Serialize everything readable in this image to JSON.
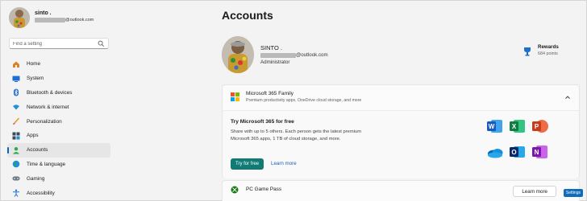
{
  "profile": {
    "name": "sinto .",
    "email_suffix": "@outlook.com"
  },
  "search": {
    "placeholder": "Find a setting"
  },
  "nav": {
    "items": [
      {
        "label": "Home",
        "icon": "home-icon"
      },
      {
        "label": "System",
        "icon": "system-icon"
      },
      {
        "label": "Bluetooth & devices",
        "icon": "bluetooth-icon"
      },
      {
        "label": "Network & internet",
        "icon": "wifi-icon"
      },
      {
        "label": "Personalization",
        "icon": "brush-icon"
      },
      {
        "label": "Apps",
        "icon": "apps-icon"
      },
      {
        "label": "Accounts",
        "icon": "accounts-icon"
      },
      {
        "label": "Time & language",
        "icon": "globe-icon"
      },
      {
        "label": "Gaming",
        "icon": "gamepad-icon"
      },
      {
        "label": "Accessibility",
        "icon": "accessibility-icon"
      }
    ],
    "active_index": 6
  },
  "main": {
    "title": "Accounts",
    "user": {
      "name": "SINTO .",
      "email_suffix": "@outlook.com",
      "role": "Administrator"
    },
    "rewards": {
      "label": "Rewards",
      "points": "684 points"
    },
    "m365": {
      "title": "Microsoft 365 Family",
      "subtitle": "Premium productivity apps, OneDrive cloud storage, and more",
      "body_title": "Try Microsoft 365 for free",
      "body_desc": "Share with up to 5 others. Each person gets the latest premium Microsoft 365 apps, 1 TB of cloud storage, and more.",
      "primary_button": "Try for free",
      "link": "Learn more"
    },
    "gamepass": {
      "title": "PC Game Pass",
      "button": "Learn more"
    }
  },
  "bubble": "Settings",
  "colors": {
    "accent": "#0067c0",
    "primary_button": "#0f7b74"
  }
}
